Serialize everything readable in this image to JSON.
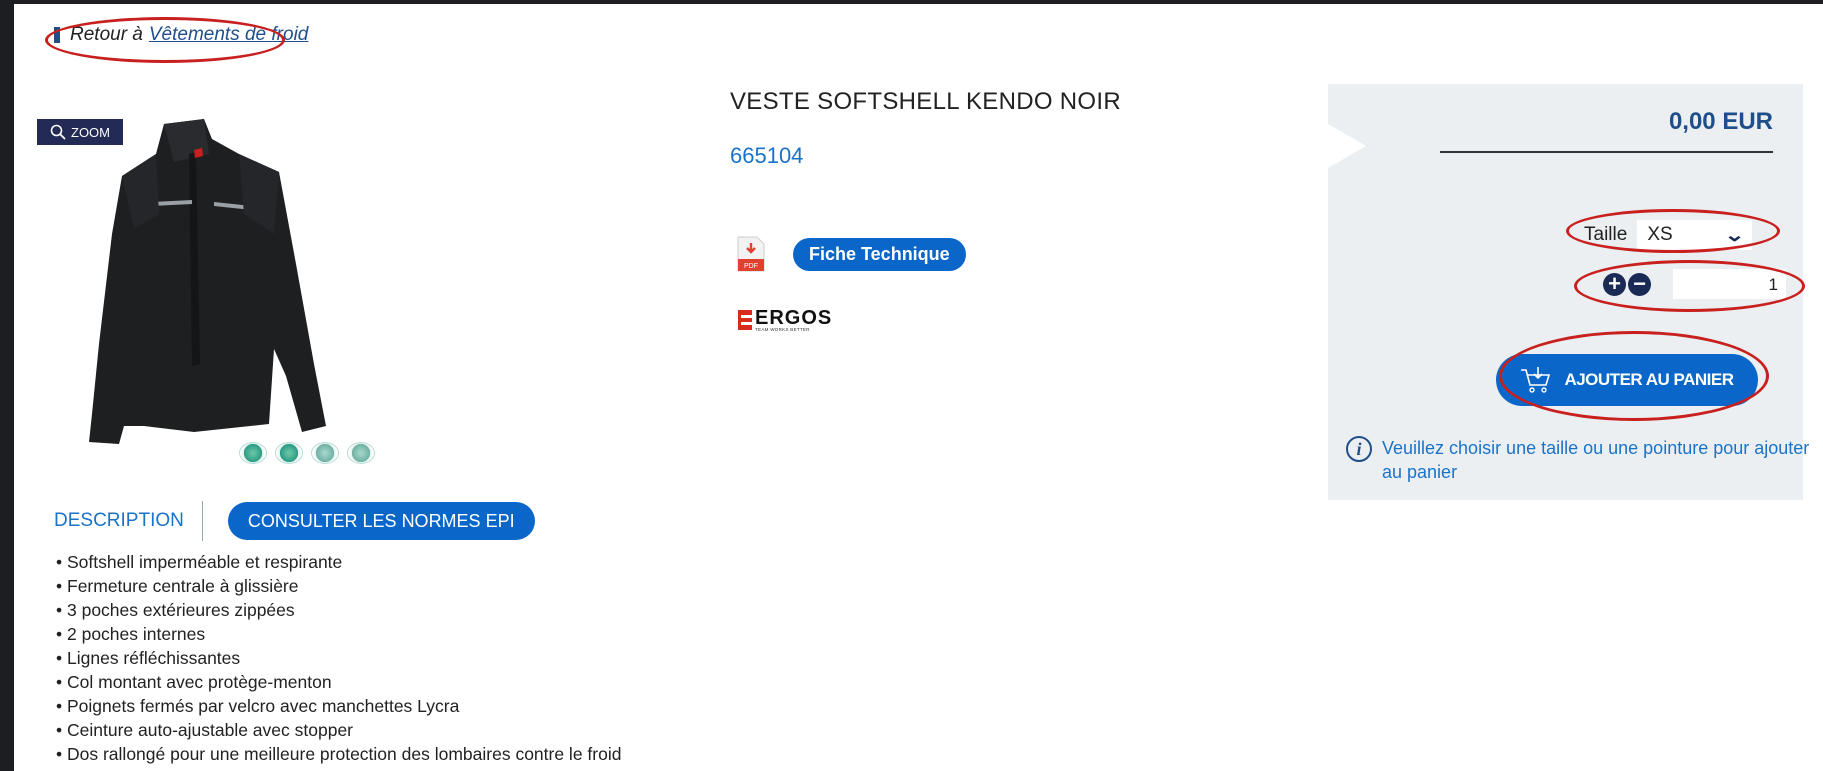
{
  "breadcrumb": {
    "prefix": "Retour à",
    "link": "Vêtements de froid"
  },
  "gallery": {
    "zoom_label": "ZOOM",
    "thumbnails": [
      "thumb-1",
      "thumb-2",
      "thumb-3",
      "thumb-4"
    ]
  },
  "product": {
    "title": "VESTE SOFTSHELL KENDO NOIR",
    "reference": "665104",
    "pdf_icon_label": "PDF",
    "fiche_label": "Fiche Technique",
    "brand_name": "ERGOS",
    "brand_tagline": "TEAM WORKS BETTER"
  },
  "tabs": {
    "description": "DESCRIPTION",
    "norms": "CONSULTER LES NORMES EPI"
  },
  "description_items": [
    "Softshell imperméable et respirante",
    "Fermeture centrale à glissière",
    "3 poches extérieures zippées",
    "2 poches internes",
    "Lignes réfléchissantes",
    "Col montant avec protège-menton",
    "Poignets fermés par velcro avec manchettes Lycra",
    "Ceinture auto-ajustable avec stopper",
    "Dos rallongé pour une meilleure protection des lombaires contre le froid"
  ],
  "cart": {
    "price": "0,00 EUR",
    "size_label": "Taille",
    "size_value": "XS",
    "qty_plus": "+",
    "qty_minus": "−",
    "quantity": "1",
    "add_label": "AJOUTER AU PANIER",
    "info_text": "Veuillez choisir une taille ou une pointure pour ajouter au panier"
  },
  "colors": {
    "primary_button": "#0a67c9",
    "navy": "#1f4f8a",
    "annotation_ring": "#c8201e",
    "panel_bg": "#eceff1"
  }
}
